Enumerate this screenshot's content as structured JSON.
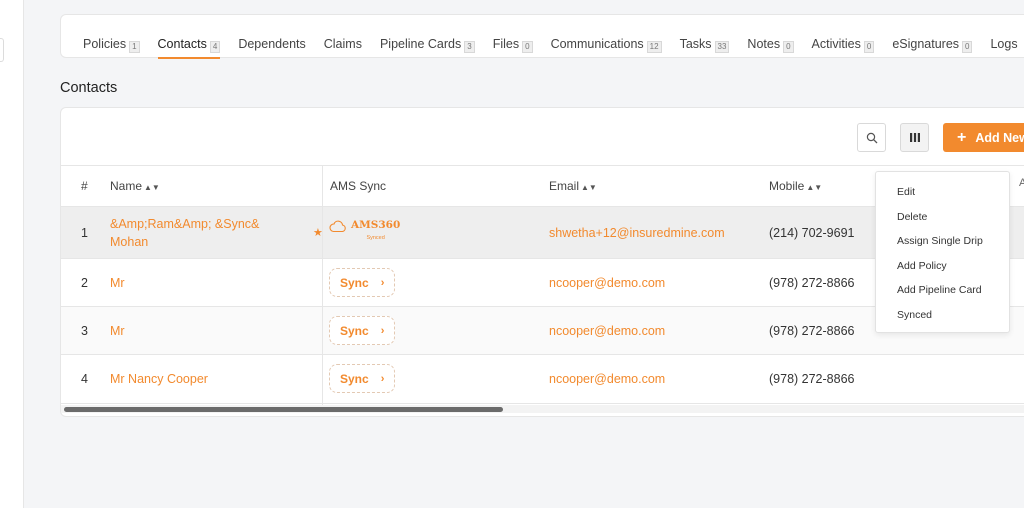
{
  "tabs": [
    {
      "label": "Policies",
      "count": "1"
    },
    {
      "label": "Contacts",
      "count": "4"
    },
    {
      "label": "Dependents",
      "count": ""
    },
    {
      "label": "Claims",
      "count": ""
    },
    {
      "label": "Pipeline Cards",
      "count": "3"
    },
    {
      "label": "Files",
      "count": "0"
    },
    {
      "label": "Communications",
      "count": "12"
    },
    {
      "label": "Tasks",
      "count": "33"
    },
    {
      "label": "Notes",
      "count": "0"
    },
    {
      "label": "Activities",
      "count": "0"
    },
    {
      "label": "eSignatures",
      "count": "0"
    },
    {
      "label": "Logs",
      "count": ""
    }
  ],
  "active_tab": "Contacts",
  "section_title": "Contacts",
  "toolbar": {
    "search_icon": "search-icon",
    "columns_icon": "columns-icon",
    "add_label": "Add New",
    "add_icon": "+"
  },
  "columns": {
    "num": "#",
    "name": "Name",
    "ams": "AMS Sync",
    "email": "Email",
    "mobile": "Mobile",
    "clipped": "A"
  },
  "rows": [
    {
      "num": "1",
      "name_line1": "&Amp;Ram&Amp; &Sync&",
      "name_line2": "Mohan",
      "ams_logo_text": "AMS360",
      "ams_logo_sub": "Synced",
      "email": "shwetha+12@insuredmine.com",
      "mobile": "(214) 702-9691"
    },
    {
      "num": "2",
      "name_line1": "Mr",
      "ams_sync_label": "Sync",
      "email": "ncooper@demo.com",
      "mobile": "(978) 272-8866"
    },
    {
      "num": "3",
      "name_line1": "Mr",
      "ams_sync_label": "Sync",
      "email": "ncooper@demo.com",
      "mobile": "(978) 272-8866"
    },
    {
      "num": "4",
      "name_line1": "Mr Nancy Cooper",
      "ams_sync_label": "Sync",
      "email": "ncooper@demo.com",
      "mobile": "(978) 272-8866"
    }
  ],
  "context_menu": [
    "Edit",
    "Delete",
    "Assign Single Drip",
    "Add Policy",
    "Add Pipeline Card",
    "Synced"
  ],
  "colors": {
    "accent": "#f28a2e",
    "text": "#333333",
    "border": "#e6e6e6"
  }
}
